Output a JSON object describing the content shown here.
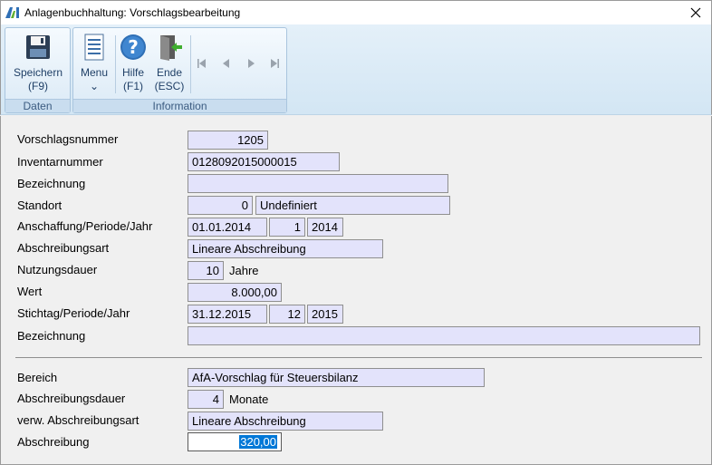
{
  "window": {
    "title": "Anlagenbuchhaltung: Vorschlagsbearbeitung"
  },
  "ribbon": {
    "groups": [
      {
        "label": "Daten"
      },
      {
        "label": "Information"
      }
    ],
    "save": {
      "line1": "Speichern",
      "line2": "(F9)"
    },
    "menu": {
      "line1": "Menu",
      "line2": "⌄"
    },
    "help": {
      "line1": "Hilfe",
      "line2": "(F1)"
    },
    "exit": {
      "line1": "Ende",
      "line2": "(ESC)"
    }
  },
  "form": {
    "vorschlagsnummer": {
      "label": "Vorschlagsnummer",
      "value": "1205"
    },
    "inventarnummer": {
      "label": "Inventarnummer",
      "value": "0128092015000015"
    },
    "bezeichnung1": {
      "label": "Bezeichnung",
      "value": ""
    },
    "standort": {
      "label": "Standort",
      "code": "0",
      "name": "Undefiniert"
    },
    "anschaffung": {
      "label": "Anschaffung/Periode/Jahr",
      "date": "01.01.2014",
      "period": "1",
      "year": "2014"
    },
    "abschreibungsart": {
      "label": "Abschreibungsart",
      "value": "Lineare Abschreibung"
    },
    "nutzungsdauer": {
      "label": "Nutzungsdauer",
      "value": "10",
      "unit": "Jahre"
    },
    "wert": {
      "label": "Wert",
      "value": "8.000,00"
    },
    "stichtag": {
      "label": "Stichtag/Periode/Jahr",
      "date": "31.12.2015",
      "period": "12",
      "year": "2015"
    },
    "bezeichnung2": {
      "label": "Bezeichnung",
      "value": ""
    },
    "bereich": {
      "label": "Bereich",
      "value": "AfA-Vorschlag für Steuersbilanz"
    },
    "abschreibungsdauer": {
      "label": "Abschreibungsdauer",
      "value": "4",
      "unit": "Monate"
    },
    "verw_abschreibungsart": {
      "label": "verw. Abschreibungsart",
      "value": "Lineare Abschreibung"
    },
    "abschreibung": {
      "label": "Abschreibung",
      "value": "320,00"
    }
  },
  "colors": {
    "field_bg": "#e3e3fb",
    "ribbon_text": "#1f3f66",
    "selection": "#0078d7"
  }
}
